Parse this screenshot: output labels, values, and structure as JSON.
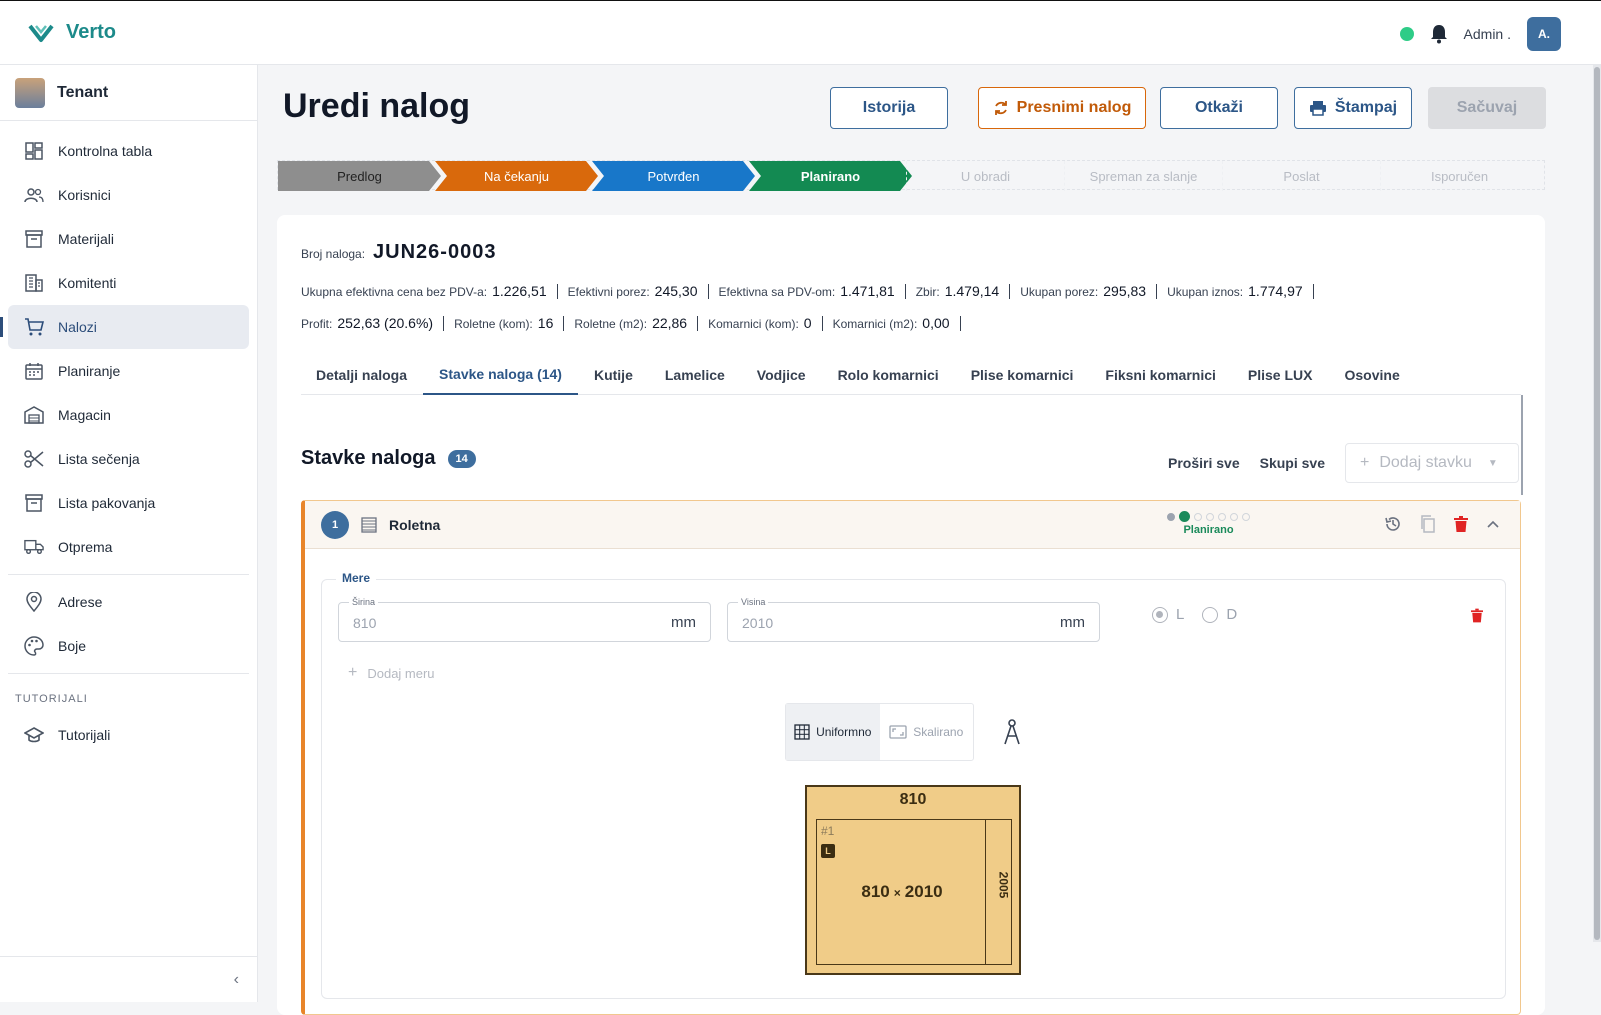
{
  "app": {
    "name": "Verto"
  },
  "topbar": {
    "user_name": "Admin .",
    "avatar_initials": "A."
  },
  "sidebar": {
    "tenant": "Tenant",
    "items": [
      {
        "label": "Kontrolna tabla",
        "icon": "dashboard-icon"
      },
      {
        "label": "Korisnici",
        "icon": "users-icon"
      },
      {
        "label": "Materijali",
        "icon": "archive-icon"
      },
      {
        "label": "Komitenti",
        "icon": "building-icon"
      },
      {
        "label": "Nalozi",
        "icon": "cart-icon",
        "active": true
      },
      {
        "label": "Planiranje",
        "icon": "calendar-icon"
      },
      {
        "label": "Magacin",
        "icon": "warehouse-icon"
      },
      {
        "label": "Lista sečenja",
        "icon": "scissors-icon"
      },
      {
        "label": "Lista pakovanja",
        "icon": "package-icon"
      },
      {
        "label": "Otprema",
        "icon": "truck-icon"
      }
    ],
    "items2": [
      {
        "label": "Adrese",
        "icon": "map-pin-icon"
      },
      {
        "label": "Boje",
        "icon": "palette-icon"
      }
    ],
    "section_title": "TUTORIJALI",
    "tutorials": {
      "label": "Tutorijali",
      "icon": "graduation-cap-icon"
    }
  },
  "page": {
    "title": "Uredi nalog",
    "actions": {
      "history": "Istorija",
      "resave": "Presnimi nalog",
      "cancel": "Otkaži",
      "print": "Štampaj",
      "save": "Sačuvaj"
    }
  },
  "stepper": [
    {
      "label": "Predlog",
      "color": "#8e8e8e",
      "text": "#222222"
    },
    {
      "label": "Na čekanju",
      "color": "#d9690c",
      "text": "#ffffff"
    },
    {
      "label": "Potvrđen",
      "color": "#1877c9",
      "text": "#ffffff"
    },
    {
      "label": "Planirano",
      "color": "#138a52",
      "text": "#ffffff",
      "bold": true
    },
    {
      "label": "U obradi"
    },
    {
      "label": "Spreman za slanje"
    },
    {
      "label": "Poslat"
    },
    {
      "label": "Isporučen"
    }
  ],
  "order": {
    "number_label": "Broj naloga:",
    "number": "JUN26-0003",
    "stats_row1": [
      {
        "label": "Ukupna efektivna cena bez PDV-a:",
        "value": "1.226,51"
      },
      {
        "label": "Efektivni porez:",
        "value": "245,30"
      },
      {
        "label": "Efektivna sa PDV-om:",
        "value": "1.471,81"
      },
      {
        "label": "Zbir:",
        "value": "1.479,14"
      },
      {
        "label": "Ukupan porez:",
        "value": "295,83"
      },
      {
        "label": "Ukupan iznos:",
        "value": "1.774,97"
      }
    ],
    "stats_row2": [
      {
        "label": "Profit:",
        "value": "252,63 (20.6%)"
      },
      {
        "label": "Roletne (kom):",
        "value": "16"
      },
      {
        "label": "Roletne (m2):",
        "value": "22,86"
      },
      {
        "label": "Komarnici (kom):",
        "value": "0"
      },
      {
        "label": "Komarnici (m2):",
        "value": "0,00"
      }
    ]
  },
  "tabs": [
    "Detalji naloga",
    "Stavke naloga (14)",
    "Kutije",
    "Lamelice",
    "Vodjice",
    "Rolo komarnici",
    "Plise komarnici",
    "Fiksni komarnici",
    "Plise LUX",
    "Osovine"
  ],
  "active_tab": 1,
  "items_section": {
    "title": "Stavke naloga",
    "count": "14",
    "expand_all": "Proširi sve",
    "collapse_all": "Skupi sve",
    "add_item": "Dodaj stavku"
  },
  "item": {
    "number": "1",
    "type": "Roletna",
    "status": "Planirano",
    "progress_step": 2,
    "progress_total": 7,
    "measures_legend": "Mere",
    "width_label": "Širina",
    "width_value": "810",
    "height_label": "Visina",
    "height_value": "2010",
    "unit": "mm",
    "side_left": "L",
    "side_right": "D",
    "selected_side": "L",
    "add_measure": "Dodaj meru",
    "view_uniform": "Uniformno",
    "view_scaled": "Skalirano",
    "preview": {
      "top_width": "810",
      "panel_no": "#1",
      "panel_side": "L",
      "panel_width": "810",
      "panel_height": "2010",
      "side_height": "2005"
    }
  },
  "colors": {
    "accent": "#3e6e9e",
    "brand": "#1c8a8a",
    "danger": "#e02424",
    "status_ok": "#2ecc87"
  }
}
